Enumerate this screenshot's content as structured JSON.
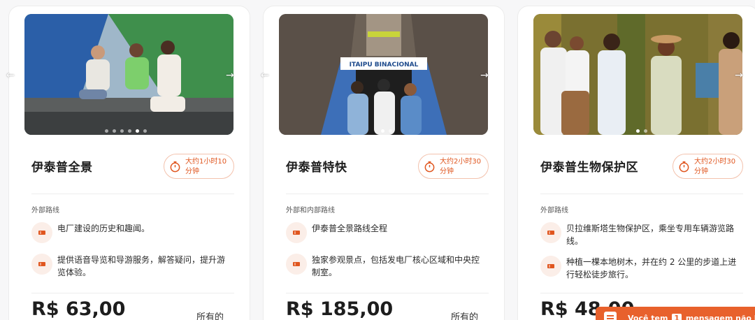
{
  "colors": {
    "accent": "#e0561f",
    "accent_soft": "#fbeee8",
    "chat_bar": "#e8612c"
  },
  "cards": [
    {
      "title": "伊泰普全景",
      "duration": "大约1小时10分钟",
      "route_type": "外部路线",
      "features": [
        "电厂建设的历史和趣闻。",
        "提供语音导览和导游服务，解答疑问，提升游览体验。"
      ],
      "price": "R$ 63,00",
      "per_label": "所有的",
      "image": "family sitting on steps in front of green wall",
      "carousel_active": 4
    },
    {
      "title": "伊泰普特快",
      "duration": "大约2小时30分钟",
      "route_type": "外部和内部路线",
      "features": [
        "伊泰普全景路线全程",
        "独家参观景点，包括发电厂核心区域和中央控制室。"
      ],
      "price": "R$ 185,00",
      "per_label": "所有的",
      "image": "visitors facing ITAIPU BINACIONAL entrance",
      "sign_text": "ITAIPU BINACIONAL",
      "carousel_active": 0
    },
    {
      "title": "伊泰普生物保护区",
      "duration": "大约2小时30分钟",
      "route_type": "外部路线",
      "features": [
        "贝拉维斯塔生物保护区，乘坐专用车辆游览路线。",
        "种植一棵本地树木，并在约 2 公里的步道上进行轻松徒步旅行。"
      ],
      "price": "R$ 48,00",
      "image": "family in forest with child",
      "carousel_active": 0
    }
  ],
  "chat": {
    "prefix": "Você tem",
    "count": "1",
    "suffix": "mensagem não lida"
  },
  "icons": {
    "duration": "stopwatch-icon",
    "feature": "ticket-icon",
    "prev": "arrow-left-icon",
    "next": "arrow-right-icon",
    "chat": "chat-icon"
  }
}
